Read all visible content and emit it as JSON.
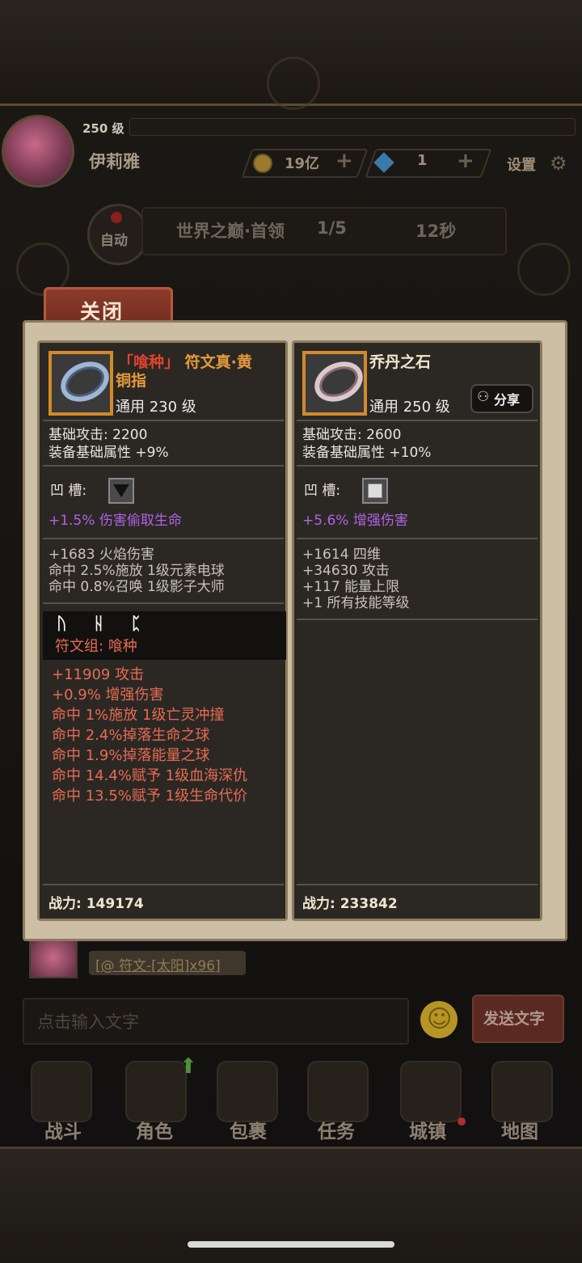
{
  "header": {
    "level": "250 级",
    "player_name": "伊莉雅",
    "gold": "19亿",
    "diamonds": "1",
    "settings_label": "设置"
  },
  "battle": {
    "auto_label": "自动",
    "stage": "世界之巅·首领",
    "progress": "1/5",
    "timer": "12秒"
  },
  "modal": {
    "close_label": "关闭",
    "left_item": {
      "name_line1_prefix": "「喰种」",
      "name_line1_suffix": " 符文真·黄",
      "name_line2": "铜指",
      "type_level": "通用 230 级",
      "base_attack": "基础攻击: 2200",
      "base_attr": "装备基础属性 +9%",
      "socket_label": "凹  槽:",
      "socket_bonus": "+1.5% 伤害偷取生命",
      "affixes": [
        "+1683 火焰伤害",
        "命中 2.5%施放 1级元素电球",
        "命中 0.8%召唤 1级影子大师"
      ],
      "runes": "ᚢ ᚺ ᛈ",
      "runeset_label": "符文组: 喰种",
      "runeset_bonuses": [
        "+11909 攻击",
        "+0.9% 增强伤害",
        "命中 1%施放 1级亡灵冲撞",
        "命中 2.4%掉落生命之球",
        "命中 1.9%掉落能量之球",
        "命中 14.4%赋予 1级血海深仇",
        "命中 13.5%赋予 1级生命代价"
      ],
      "power": "战力: 149174"
    },
    "right_item": {
      "name": "乔丹之石",
      "type_level": "通用 250 级",
      "share_label": "分享",
      "base_attack": "基础攻击: 2600",
      "base_attr": "装备基础属性 +10%",
      "socket_label": "凹  槽:",
      "socket_bonus": "+5.6% 增强伤害",
      "affixes": [
        "+1614 四维",
        "+34630 攻击",
        "+117 能量上限",
        "+1 所有技能等级"
      ],
      "power": "战力: 233842"
    }
  },
  "chat": {
    "last_message": "[@ 符文-[太阳]x96]",
    "input_placeholder": "点击输入文字",
    "send_label": "发送文字"
  },
  "nav": {
    "items": [
      "战斗",
      "角色",
      "包裹",
      "任务",
      "城镇",
      "地图"
    ]
  },
  "colors": {
    "accent_orange": "#d38a28",
    "rune_purple": "#b062e6",
    "runeset_red": "#e76b52",
    "close_tab": "#8c3b2a"
  }
}
